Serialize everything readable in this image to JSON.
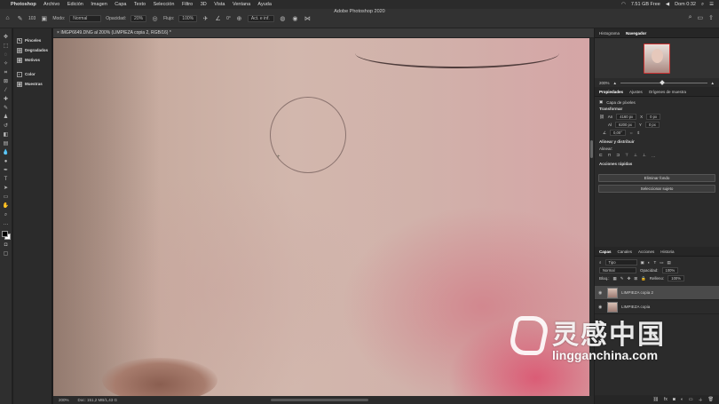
{
  "menubar": {
    "items": [
      "Photoshop",
      "Archivo",
      "Edición",
      "Imagen",
      "Capa",
      "Texto",
      "Selección",
      "Filtro",
      "3D",
      "Vista",
      "Ventana",
      "Ayuda"
    ],
    "disk": "7.51 GB Free",
    "clock": "Dom 0:32"
  },
  "options": {
    "window_title": "Adobe Photoshop 2020",
    "brush_size": "103",
    "mode_label": "Modo:",
    "mode_value": "Normal",
    "opacity_label": "Opacidad:",
    "opacity_value": "20%",
    "flow_label": "Flujo:",
    "flow_value": "100%",
    "angle": "0°",
    "sample_label": "Act. e inf."
  },
  "dock": {
    "items": [
      "Pinceles",
      "Degradados",
      "Motivos",
      "Color",
      "Muestras"
    ]
  },
  "document": {
    "tab": "IMGP6649.DNG al 200% (LIMPIEZA copia 2, RGB/16) *",
    "zoom": "200%",
    "doc_info": "Doc: 151,2 MB/1,43 G"
  },
  "navigator": {
    "tabs": [
      "Histograma",
      "Navegador"
    ],
    "zoom": "200%"
  },
  "properties": {
    "tabs": [
      "Propiedades",
      "Ajustes",
      "Orígenes de muestra"
    ],
    "layer_type": "Capa de píxeles",
    "transform_title": "Transformar",
    "w_label": "An",
    "w_value": "4160 px",
    "x_label": "X",
    "x_value": "0 px",
    "h_label": "Al",
    "h_value": "6200 px",
    "y_label": "Y",
    "y_value": "0 px",
    "angle_value": "0,00°",
    "align_title": "Alinear y distribuir",
    "align_label": "Alinear:",
    "quick_title": "Acciones rápidas",
    "btn_remove_bg": "Eliminar fondo",
    "btn_select_subject": "Seleccionar sujeto"
  },
  "layers": {
    "tabs": [
      "Capas",
      "Canales",
      "Acciones",
      "Historia"
    ],
    "filter": "Tipo",
    "blend": "Normal",
    "opacity_label": "Opacidad:",
    "opacity_value": "100%",
    "lock_label": "Bloq.:",
    "fill_label": "Relleno:",
    "fill_value": "100%",
    "rows": [
      "LIMPIEZA copia 2",
      "LIMPIEZA copia"
    ]
  },
  "watermark": {
    "chinese": "灵感中国",
    "url": "lingganchina.com"
  }
}
